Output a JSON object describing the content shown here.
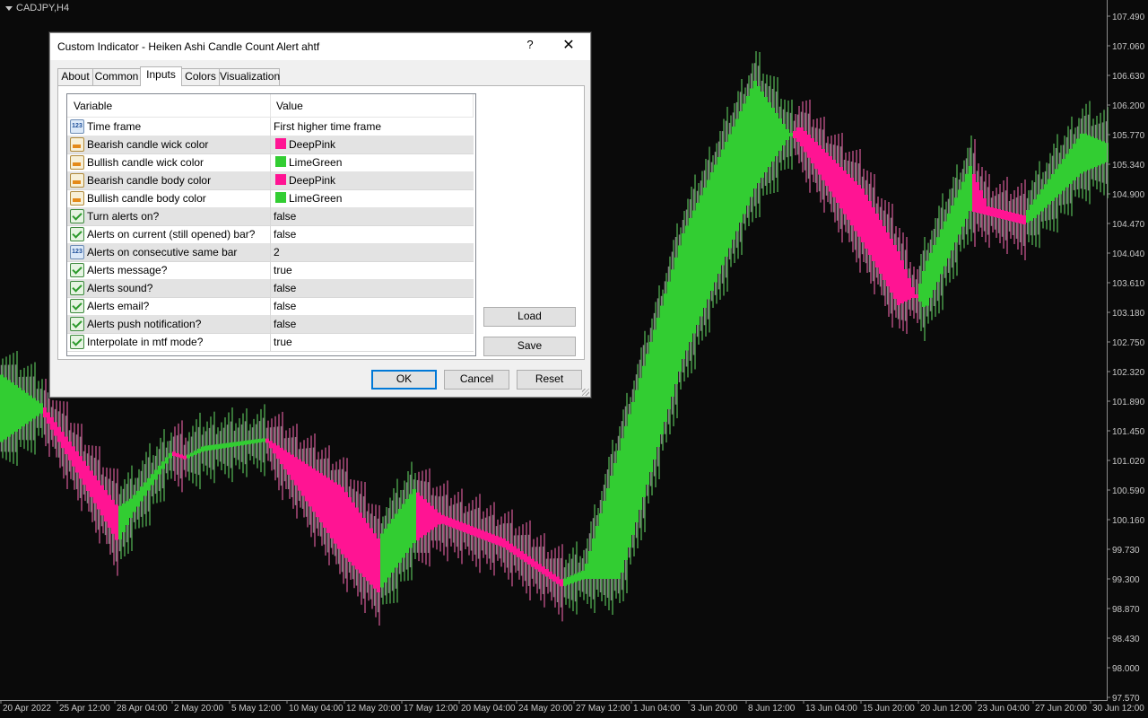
{
  "chart": {
    "symbol": "CADJPY,H4",
    "price_labels": [
      "107.490",
      "107.060",
      "106.630",
      "106.200",
      "105.770",
      "105.340",
      "104.900",
      "104.470",
      "104.040",
      "103.610",
      "103.180",
      "102.750",
      "102.320",
      "101.890",
      "101.450",
      "101.020",
      "100.590",
      "100.160",
      "99.730",
      "99.300",
      "98.870",
      "98.430",
      "98.000",
      "97.570"
    ],
    "date_labels": [
      "20 Apr 2022",
      "25 Apr 12:00",
      "28 Apr 04:00",
      "2 May 20:00",
      "5 May 12:00",
      "10 May 04:00",
      "12 May 20:00",
      "17 May 12:00",
      "20 May 04:00",
      "24 May 20:00",
      "27 May 12:00",
      "1 Jun 04:00",
      "3 Jun 20:00",
      "8 Jun 12:00",
      "13 Jun 04:00",
      "15 Jun 20:00",
      "20 Jun 12:00",
      "23 Jun 04:00",
      "27 Jun 20:00",
      "30 Jun 12:00"
    ],
    "colors": {
      "bearish": "#ff1493",
      "bullish": "#32cd32",
      "bearish_wick": "#ff69b4",
      "bullish_wick": "#66dd66",
      "base_candle": "#808080",
      "axis_text": "#c8c8c8"
    }
  },
  "dialog": {
    "title": "Custom Indicator - Heiken Ashi Candle Count Alert ahtf",
    "help_icon": "?",
    "close_icon": "✕",
    "tabs": [
      "About",
      "Common",
      "Inputs",
      "Colors",
      "Visualization"
    ],
    "active_tab": "Inputs",
    "grid_header": {
      "variable": "Variable",
      "value": "Value"
    },
    "rows": [
      {
        "icon": "number-icon",
        "variable": "Time frame",
        "value": "First higher time frame"
      },
      {
        "icon": "color-icon",
        "variable": "Bearish candle wick color",
        "value": "DeepPink",
        "swatch": "#ff1493"
      },
      {
        "icon": "color-icon",
        "variable": "Bullish candle wick color",
        "value": "LimeGreen",
        "swatch": "#32cd32"
      },
      {
        "icon": "color-icon",
        "variable": "Bearish candle body color",
        "value": "DeepPink",
        "swatch": "#ff1493"
      },
      {
        "icon": "color-icon",
        "variable": "Bullish candle body color",
        "value": "LimeGreen",
        "swatch": "#32cd32"
      },
      {
        "icon": "bool-icon",
        "variable": "Turn alerts on?",
        "value": "false"
      },
      {
        "icon": "bool-icon",
        "variable": "Alerts on current (still opened) bar?",
        "value": "false"
      },
      {
        "icon": "number-icon",
        "variable": "Alerts on consecutive same bar",
        "value": "2"
      },
      {
        "icon": "bool-icon",
        "variable": "Alerts message?",
        "value": "true"
      },
      {
        "icon": "bool-icon",
        "variable": "Alerts sound?",
        "value": "false"
      },
      {
        "icon": "bool-icon",
        "variable": "Alerts email?",
        "value": "false"
      },
      {
        "icon": "bool-icon",
        "variable": "Alerts push notification?",
        "value": "false"
      },
      {
        "icon": "bool-icon",
        "variable": "Interpolate in mtf mode?",
        "value": "true"
      }
    ],
    "buttons": {
      "load": "Load",
      "save": "Save",
      "ok": "OK",
      "cancel": "Cancel",
      "reset": "Reset"
    }
  }
}
